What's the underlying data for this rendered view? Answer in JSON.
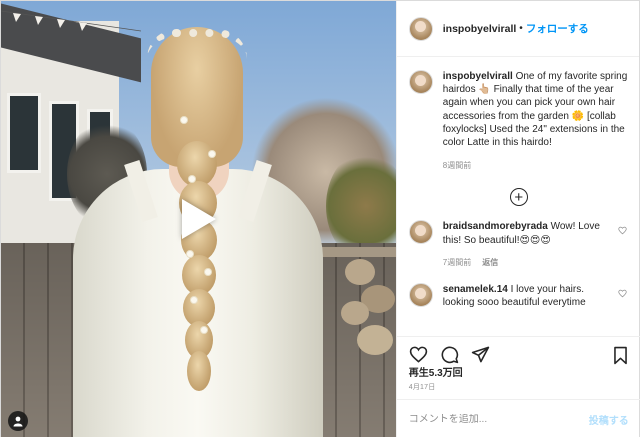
{
  "header": {
    "username": "inspobyelvirall",
    "separator": "•",
    "follow_label": "フォローする"
  },
  "caption": {
    "username": "inspobyelvirall",
    "text": "One of my favorite spring hairdos 👆🏼 Finally that time of the year again when you can pick your own hair accessories from the garden 🌼 [collab foxylocks] Used the 24\" extensions in the color Latte in this hairdo!",
    "timestamp": "8週間前"
  },
  "load_more_icon": "plus-circle-icon",
  "comments": [
    {
      "username": "braidsandmorebyrada",
      "text": "Wow! Love this! So beautiful!😍😍😍",
      "timestamp": "7週間前",
      "reply_label": "返信"
    },
    {
      "username": "senamelek.14",
      "text": "I love your hairs. looking sooo beautiful everytime",
      "timestamp": "",
      "reply_label": ""
    }
  ],
  "actions": {
    "icons": [
      "heart-icon",
      "comment-icon",
      "share-icon",
      "bookmark-icon"
    ]
  },
  "views_label": "再生5.3万回",
  "date_label": "4月17日",
  "add_comment": {
    "placeholder": "コメントを追加...",
    "post_label": "投稿する"
  },
  "colors": {
    "accent": "#0095f6",
    "post_disabled": "#b2dffc",
    "muted": "#8e8e8e",
    "text": "#262626"
  }
}
